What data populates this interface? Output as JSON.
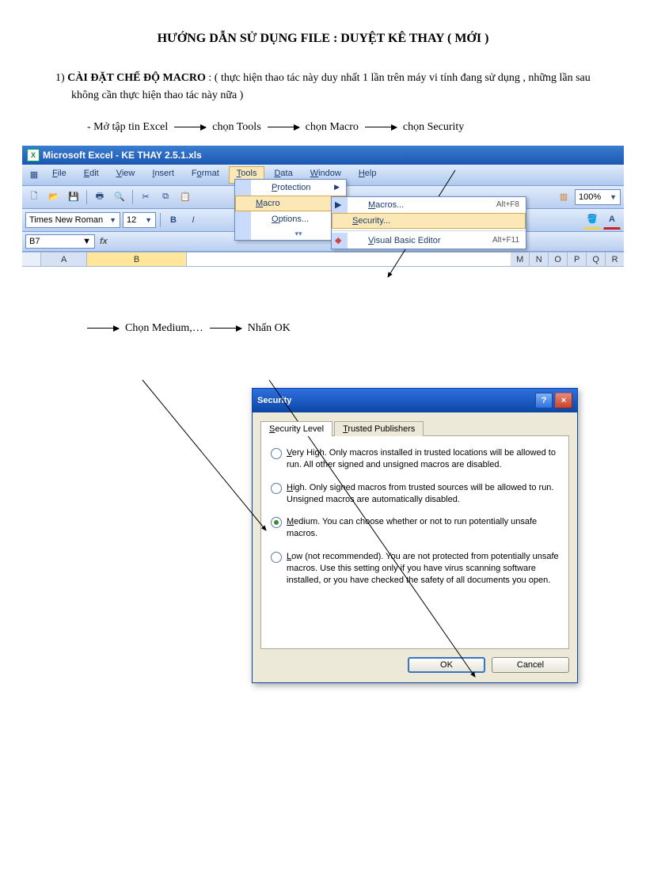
{
  "doc": {
    "title": "HƯỚNG DẪN SỬ DỤNG FILE :    DUYỆT KÊ THAY  ( MỚI )",
    "section1_num": "1)",
    "section1_head": "CÀI ĐẶT CHẾ ĐỘ  MACRO",
    "section1_body": ": ( thực hiện thao tác này duy nhất 1 lần trên máy vi tính đang sử dụng , những lần sau không cần thực hiện thao tác này nữa )",
    "flow1_a": "-  Mở tập tin Excel",
    "flow1_b": "chọn Tools",
    "flow1_c": "chọn Macro",
    "flow1_d": "chọn Security",
    "flow2_a": "Chọn Medium,…",
    "flow2_b": "Nhấn OK"
  },
  "excel": {
    "title": "Microsoft Excel - KE THAY 2.5.1.xls",
    "menus": [
      "File",
      "Edit",
      "View",
      "Insert",
      "Format",
      "Tools",
      "Data",
      "Window",
      "Help"
    ],
    "font_name": "Times New Roman",
    "font_size": "12",
    "namebox": "B7",
    "zoom": "100%",
    "cols_left": [
      "A",
      "B"
    ],
    "cols_right": [
      "M",
      "N",
      "O",
      "P",
      "Q",
      "R"
    ],
    "tools_menu": {
      "protection": "Protection",
      "macro": "Macro",
      "options": "Options..."
    },
    "macro_submenu": {
      "macros": "Macros...",
      "macros_sc": "Alt+F8",
      "security": "Security...",
      "vbe": "Visual Basic Editor",
      "vbe_sc": "Alt+F11"
    }
  },
  "dialog": {
    "title": "Security",
    "tab1": "Security Level",
    "tab2": "Trusted Publishers",
    "opt_vh": "Very High. Only macros installed in trusted locations will be allowed to run. All other signed and unsigned macros are disabled.",
    "opt_h": "High. Only signed macros from trusted sources will be allowed to run. Unsigned macros are automatically disabled.",
    "opt_m": "Medium. You can choose whether or not to run potentially unsafe macros.",
    "opt_l": "Low (not recommended). You are not protected from potentially unsafe macros. Use this setting only if you have virus scanning software installed, or you have checked the safety of all documents you open.",
    "ok": "OK",
    "cancel": "Cancel"
  }
}
